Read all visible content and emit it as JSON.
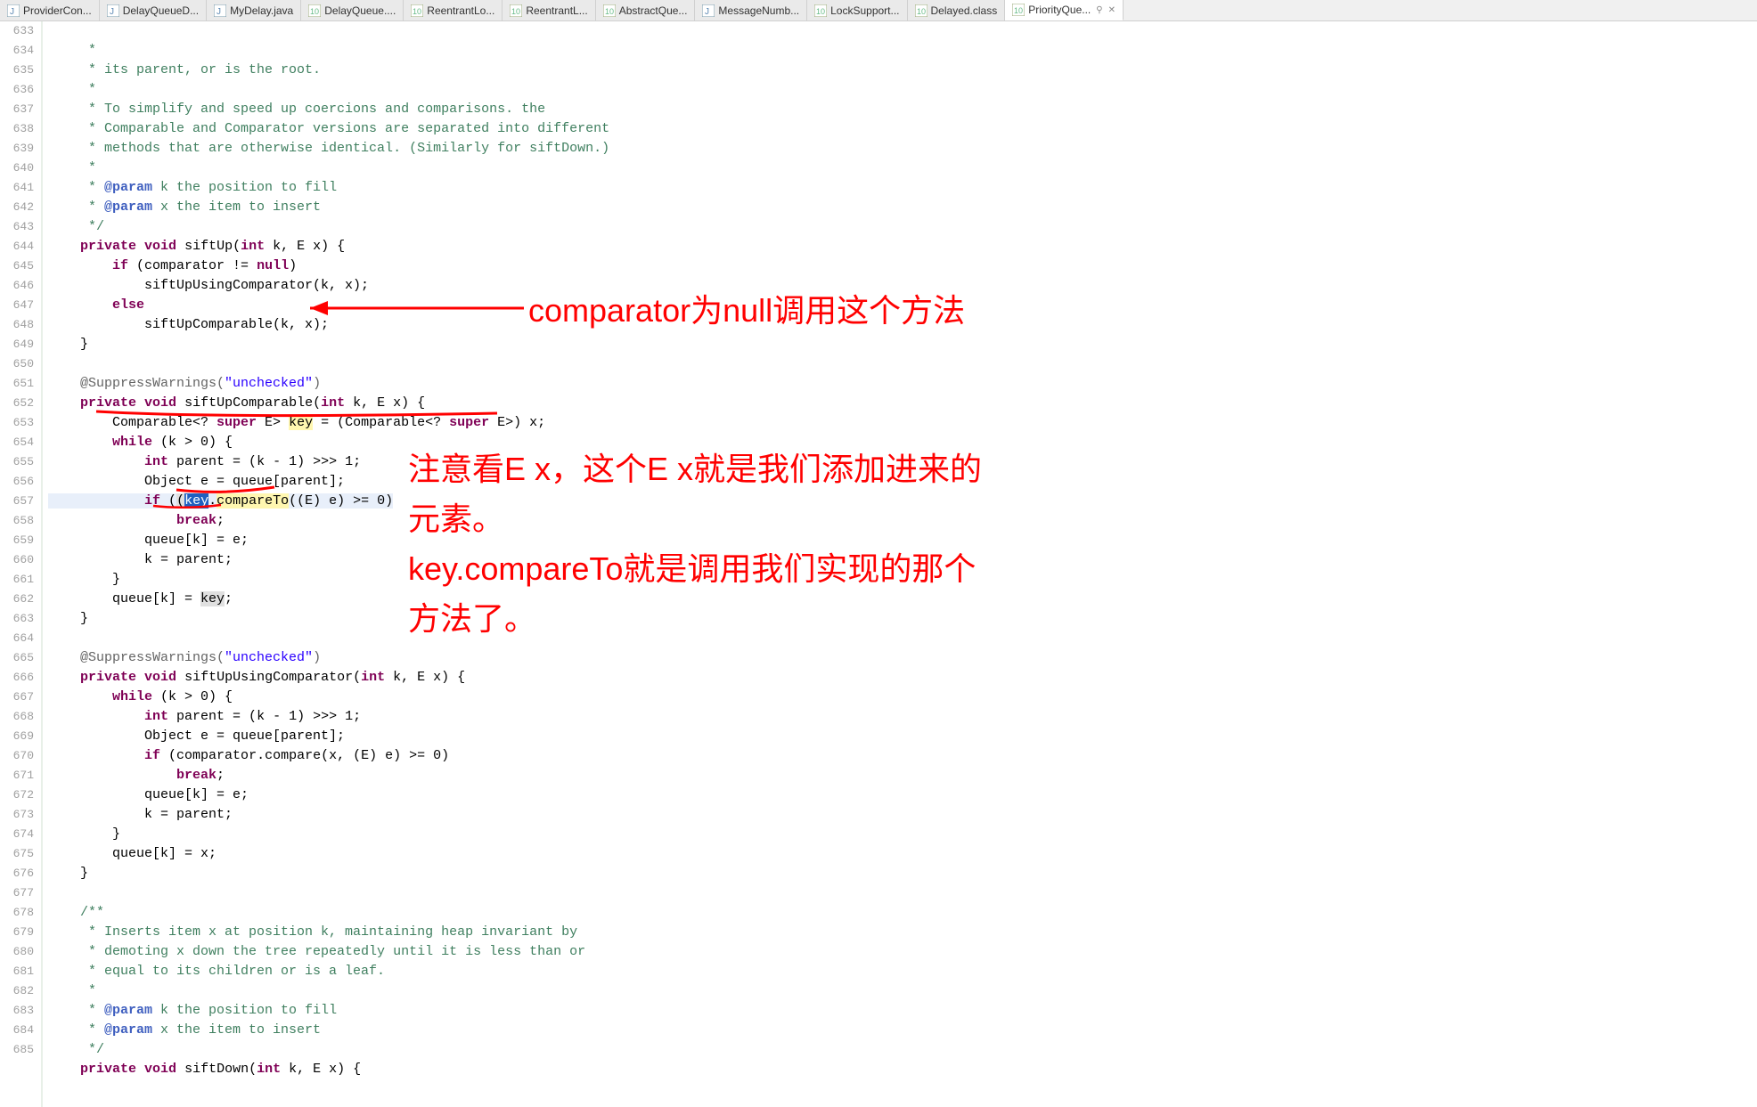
{
  "tabs": [
    {
      "label": "ProviderCon..."
    },
    {
      "label": "DelayQueueD..."
    },
    {
      "label": "MyDelay.java"
    },
    {
      "label": "DelayQueue...."
    },
    {
      "label": "ReentrantLo..."
    },
    {
      "label": "ReentrantL..."
    },
    {
      "label": "AbstractQue..."
    },
    {
      "label": "MessageNumb..."
    },
    {
      "label": "LockSupport..."
    },
    {
      "label": "Delayed.class"
    },
    {
      "label": "PriorityQue...",
      "active": true
    }
  ],
  "gutter": [
    "633",
    "634",
    "635",
    "636",
    "637",
    "638",
    "639",
    "640",
    "641",
    "642",
    "643",
    "644",
    "645",
    "646",
    "647",
    "648",
    "649",
    "650",
    "651",
    "652",
    "653",
    "654",
    "655",
    "656",
    "657",
    "658",
    "659",
    "660",
    "661",
    "662",
    "663",
    "664",
    "665",
    "666",
    "667",
    "668",
    "669",
    "670",
    "671",
    "672",
    "673",
    "674",
    "675",
    "676",
    "677",
    "678",
    "679",
    "680",
    "681",
    "682",
    "683",
    "684",
    "685"
  ],
  "code": {
    "l633": "     *                                                                     ",
    "l634": "     * its parent, or is the root.",
    "l635": "     *",
    "l636": "     * To simplify and speed up coercions and comparisons. the",
    "l637": "     * Comparable and Comparator versions are separated into different",
    "l638": "     * methods that are otherwise identical. (Similarly for siftDown.)",
    "l639": "     *",
    "l640_a": "     * ",
    "l640_b": "@param",
    "l640_c": " k the position to fill",
    "l641_a": "     * ",
    "l641_b": "@param",
    "l641_c": " x the item to insert",
    "l642": "     */",
    "l643_a": "private",
    "l643_b": " ",
    "l643_c": "void",
    "l643_d": " siftUp(",
    "l643_e": "int",
    "l643_f": " k, E x) {",
    "l644_a": "        ",
    "l644_b": "if",
    "l644_c": " (comparator != ",
    "l644_d": "null",
    "l644_e": ")",
    "l645": "            siftUpUsingComparator(k, x);",
    "l646_a": "        ",
    "l646_b": "else",
    "l647": "            siftUpComparable(k, x);",
    "l648": "    }",
    "l650_a": "    @SuppressWarnings(",
    "l650_b": "\"unchecked\"",
    "l650_c": ")",
    "l651_a": "private",
    "l651_b": " ",
    "l651_c": "void",
    "l651_d": " siftUpComparable(",
    "l651_e": "int",
    "l651_f": " k, E x) {",
    "l652_a": "        Comparable<? ",
    "l652_b": "super",
    "l652_c": " E> ",
    "l652_d": "key",
    "l652_e": " = (Comparable<? ",
    "l652_f": "super",
    "l652_g": " E>) x;",
    "l653_a": "        ",
    "l653_b": "while",
    "l653_c": " (k > 0) {",
    "l654_a": "            ",
    "l654_b": "int",
    "l654_c": " parent = (k - 1) >>> 1;",
    "l655": "            Object e = queue[parent];",
    "l656_a": "            ",
    "l656_b": "if",
    "l656_c": " (",
    "l656_sel": "key",
    "l656_d": ".",
    "l656_e": "compareTo",
    "l656_f": "((E) e) >= 0)",
    "l657_a": "                ",
    "l657_b": "break",
    "l657_c": ";",
    "l658": "            queue[k] = e;",
    "l659": "            k = parent;",
    "l660": "        }",
    "l661_a": "        queue[k] = ",
    "l661_b": "key",
    "l661_c": ";",
    "l662": "    }",
    "l664_a": "    @SuppressWarnings(",
    "l664_b": "\"unchecked\"",
    "l664_c": ")",
    "l665_a": "private",
    "l665_b": " ",
    "l665_c": "void",
    "l665_d": " siftUpUsingComparator(",
    "l665_e": "int",
    "l665_f": " k, E x) {",
    "l666_a": "        ",
    "l666_b": "while",
    "l666_c": " (k > 0) {",
    "l667_a": "            ",
    "l667_b": "int",
    "l667_c": " parent = (k - 1) >>> 1;",
    "l668": "            Object e = queue[parent];",
    "l669_a": "            ",
    "l669_b": "if",
    "l669_c": " (comparator.compare(x, (E) e) >= 0)",
    "l670_a": "                ",
    "l670_b": "break",
    "l670_c": ";",
    "l671": "            queue[k] = e;",
    "l672": "            k = parent;",
    "l673": "        }",
    "l674": "        queue[k] = x;",
    "l675": "    }",
    "l677": "    /**",
    "l678": "     * Inserts item x at position k, maintaining heap invariant by",
    "l679": "     * demoting x down the tree repeatedly until it is less than or",
    "l680": "     * equal to its children or is a leaf.",
    "l681": "     *",
    "l682_a": "     * ",
    "l682_b": "@param",
    "l682_c": " k the position to fill",
    "l683_a": "     * ",
    "l683_b": "@param",
    "l683_c": " x the item to insert",
    "l684": "     */",
    "l685_a": "private",
    "l685_b": " ",
    "l685_c": "void",
    "l685_d": " siftDown(",
    "l685_e": "int",
    "l685_f": " k, E x) {"
  },
  "annotations": {
    "a1": "comparator为null调用这个方法",
    "a2": "注意看E x，这个E x就是我们添加进来的",
    "a3": "元素。",
    "a4": "key.compareTo就是调用我们实现的那个",
    "a5": "方法了。"
  }
}
